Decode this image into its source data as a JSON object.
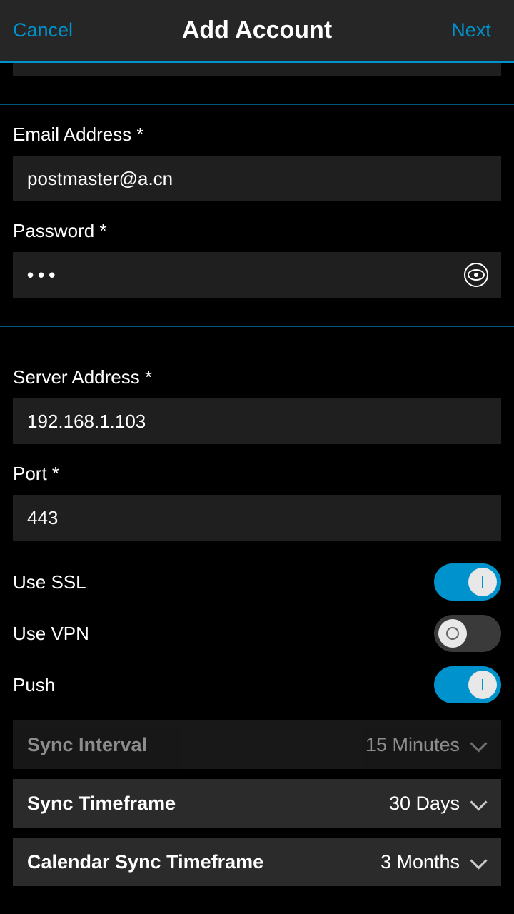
{
  "header": {
    "cancel": "Cancel",
    "title": "Add Account",
    "next": "Next"
  },
  "fields": {
    "email_label": "Email Address *",
    "email_value": "postmaster@a.cn",
    "password_label": "Password *",
    "password_masked": "•••",
    "server_label": "Server Address *",
    "server_value": "192.168.1.103",
    "port_label": "Port *",
    "port_value": "443"
  },
  "toggles": {
    "ssl_label": "Use SSL",
    "ssl_on": true,
    "vpn_label": "Use VPN",
    "vpn_on": false,
    "push_label": "Push",
    "push_on": true
  },
  "selects": {
    "sync_interval_label": "Sync Interval",
    "sync_interval_value": "15 Minutes",
    "sync_interval_disabled": true,
    "sync_timeframe_label": "Sync Timeframe",
    "sync_timeframe_value": "30 Days",
    "cal_label": "Calendar Sync Timeframe",
    "cal_value": "3 Months"
  }
}
